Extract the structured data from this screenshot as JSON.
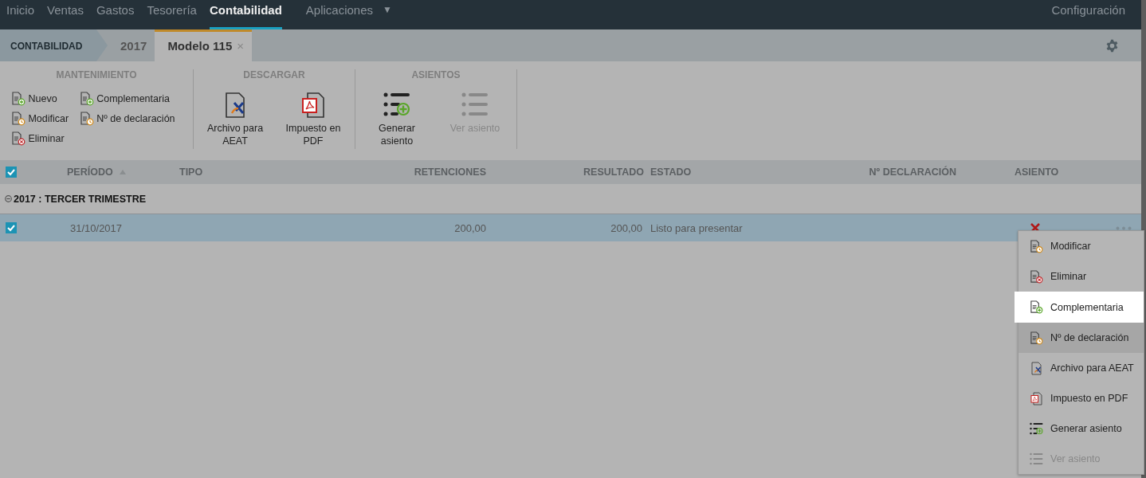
{
  "nav": {
    "items": [
      {
        "label": "Inicio",
        "selected": false
      },
      {
        "label": "Ventas",
        "selected": false
      },
      {
        "label": "Gastos",
        "selected": false
      },
      {
        "label": "Tesorería",
        "selected": false
      },
      {
        "label": "Contabilidad",
        "selected": true
      },
      {
        "label": "Aplicaciones",
        "selected": false,
        "caret": "▼"
      }
    ],
    "right": "Configuración"
  },
  "breadcrumb": {
    "root": "CONTABILIDAD",
    "items": [
      {
        "label": "2017",
        "selected": false
      },
      {
        "label": "Modelo 115",
        "selected": true,
        "close": "×"
      }
    ]
  },
  "toolbar": {
    "groups": [
      {
        "title": "MANTENIMIENTO",
        "kind": "small",
        "items": [
          {
            "label": "Nuevo",
            "kind": "add",
            "disabled": false
          },
          {
            "label": "Modificar",
            "kind": "edit",
            "disabled": false
          },
          {
            "label": "Eliminar",
            "kind": "delete",
            "disabled": false
          },
          {
            "label": "Complementaria",
            "kind": "add",
            "disabled": false
          },
          {
            "label": "Nº de declaración",
            "kind": "edit",
            "disabled": false
          }
        ]
      },
      {
        "title": "DESCARGAR",
        "kind": "large",
        "items": [
          {
            "label": "Archivo para AEAT",
            "kind": "aeat",
            "disabled": false
          },
          {
            "label": "Impuesto en PDF",
            "kind": "pdf",
            "disabled": false
          }
        ]
      },
      {
        "title": "ASIENTOS",
        "kind": "large",
        "items": [
          {
            "label": "Generar asiento",
            "kind": "generate",
            "disabled": false
          },
          {
            "label": "Ver asiento",
            "kind": "list",
            "disabled": true
          }
        ]
      }
    ]
  },
  "table": {
    "all_checked": true,
    "columns": [
      {
        "label": "PERÍODO",
        "sorted": true
      },
      {
        "label": "TIPO",
        "sorted": false
      },
      {
        "label": "RETENCIONES",
        "sorted": false
      },
      {
        "label": "RESULTADO",
        "sorted": false
      },
      {
        "label": "ESTADO",
        "sorted": false
      },
      {
        "label": "Nº DECLARACIÓN",
        "sorted": false
      },
      {
        "label": "ASIENTO",
        "sorted": false
      }
    ],
    "groups": [
      {
        "label": "2017 : TERCER TRIMESTRE",
        "expanded": true,
        "rows": [
          {
            "checked": true,
            "selected": true,
            "periodo": "31/10/2017",
            "retenciones": "200,00",
            "resultado": "200,00",
            "estado": "Listo para presentar",
            "asiento_generated": false
          }
        ]
      }
    ]
  },
  "menu": {
    "items": [
      {
        "label": "Modificar",
        "kind": "edit",
        "selected": false,
        "hovered": false,
        "disabled": false
      },
      {
        "label": "Eliminar",
        "kind": "delete",
        "selected": false,
        "hovered": false,
        "disabled": false
      },
      {
        "label": "Complementaria",
        "kind": "add",
        "selected": true,
        "hovered": false,
        "disabled": false
      },
      {
        "label": "Nº de declaración",
        "kind": "edit",
        "selected": false,
        "hovered": true,
        "disabled": false
      },
      {
        "label": "Archivo para AEAT",
        "kind": "aeat",
        "selected": false,
        "hovered": false,
        "disabled": false
      },
      {
        "label": "Impuesto en PDF",
        "kind": "pdf",
        "selected": false,
        "hovered": false,
        "disabled": false
      },
      {
        "label": "Generar asiento",
        "kind": "generate",
        "selected": false,
        "hovered": false,
        "disabled": false
      },
      {
        "label": "Ver asiento",
        "kind": "list",
        "selected": false,
        "hovered": false,
        "disabled": true
      }
    ]
  }
}
